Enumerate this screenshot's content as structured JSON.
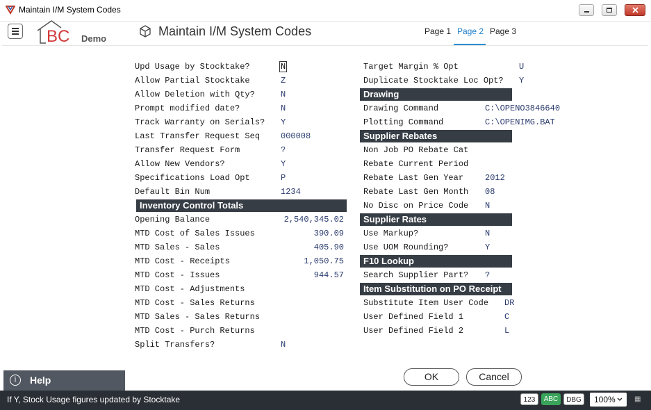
{
  "window": {
    "title": "Maintain I/M System Codes"
  },
  "header": {
    "brand": "BC",
    "edition": "Demo",
    "title": "Maintain I/M System Codes",
    "tabs": [
      "Page 1",
      "Page 2",
      "Page 3"
    ],
    "active_tab": "Page 2"
  },
  "left_fields": [
    {
      "label": "Upd Usage by Stocktake?",
      "value": "N"
    },
    {
      "label": "Allow Partial Stocktake",
      "value": "Z"
    },
    {
      "label": "Allow Deletion with Qty?",
      "value": "N"
    },
    {
      "label": "Prompt modified date?",
      "value": "N"
    },
    {
      "label": "Track Warranty on Serials?",
      "value": "Y"
    },
    {
      "label": "Last Transfer Request Seq",
      "value": "000008"
    },
    {
      "label": "Transfer Request Form",
      "value": "?"
    },
    {
      "label": "Allow New Vendors?",
      "value": "Y"
    },
    {
      "label": "Specifications Load Opt",
      "value": "P"
    },
    {
      "label": "Default Bin Num",
      "value": "1234"
    }
  ],
  "inventory_totals": {
    "heading": "Inventory Control Totals",
    "rows": [
      {
        "label": "Opening Balance",
        "value": "2,540,345.02"
      },
      {
        "label": "MTD Cost of Sales Issues",
        "value": "390.09"
      },
      {
        "label": "MTD Sales - Sales",
        "value": "405.90"
      },
      {
        "label": "MTD Cost - Receipts",
        "value": "1,050.75"
      },
      {
        "label": "MTD Cost - Issues",
        "value": "944.57"
      },
      {
        "label": "MTD Cost - Adjustments",
        "value": ""
      },
      {
        "label": "MTD Cost - Sales Returns",
        "value": ""
      },
      {
        "label": "MTD Sales - Sales Returns",
        "value": ""
      },
      {
        "label": "MTD Cost - Purch Returns",
        "value": ""
      }
    ]
  },
  "split_transfers": {
    "label": "Split Transfers?",
    "value": "N"
  },
  "right_top": [
    {
      "label": "Target Margin % Opt",
      "value": "U"
    },
    {
      "label": "Duplicate Stocktake Loc Opt?",
      "value": "Y"
    }
  ],
  "drawing": {
    "heading": "Drawing",
    "rows": [
      {
        "label": "Drawing Command",
        "value": "C:\\OPENO3846640"
      },
      {
        "label": "Plotting Command",
        "value": "C:\\OPENIMG.BAT"
      }
    ]
  },
  "supplier_rebates": {
    "heading": "Supplier Rebates",
    "rows": [
      {
        "label": "Non Job PO Rebate Cat",
        "value": ""
      },
      {
        "label": "Rebate Current Period",
        "value": ""
      },
      {
        "label": "Rebate Last Gen Year",
        "value": "2012"
      },
      {
        "label": "Rebate Last Gen Month",
        "value": "08"
      },
      {
        "label": "No Disc on Price Code",
        "value": "N"
      }
    ]
  },
  "supplier_rates": {
    "heading": "Supplier Rates",
    "rows": [
      {
        "label": "Use Markup?",
        "value": "N"
      },
      {
        "label": "Use UOM Rounding?",
        "value": "Y"
      }
    ]
  },
  "f10_lookup": {
    "heading": "F10 Lookup",
    "rows": [
      {
        "label": "Search Supplier Part?",
        "value": "?"
      }
    ]
  },
  "item_substitution": {
    "heading": "Item Substitution on PO Receipt",
    "rows": [
      {
        "label": "Substitute Item User Code",
        "value": "DR"
      },
      {
        "label": "User Defined Field 1",
        "value": "C"
      },
      {
        "label": "User Defined Field 2",
        "value": "L"
      }
    ]
  },
  "buttons": {
    "ok": "OK",
    "cancel": "Cancel"
  },
  "help": {
    "label": "Help"
  },
  "status": {
    "message": "If Y, Stock Usage figures updated by Stocktake",
    "badge_123": "123",
    "badge_abc": "ABC",
    "badge_dbg": "DBG",
    "zoom": "100%"
  },
  "colors": {
    "section_header": "#373d45",
    "accent": "#2a8ad3",
    "value_text": "#2a3a6e",
    "status_bar": "#2a2f35"
  }
}
